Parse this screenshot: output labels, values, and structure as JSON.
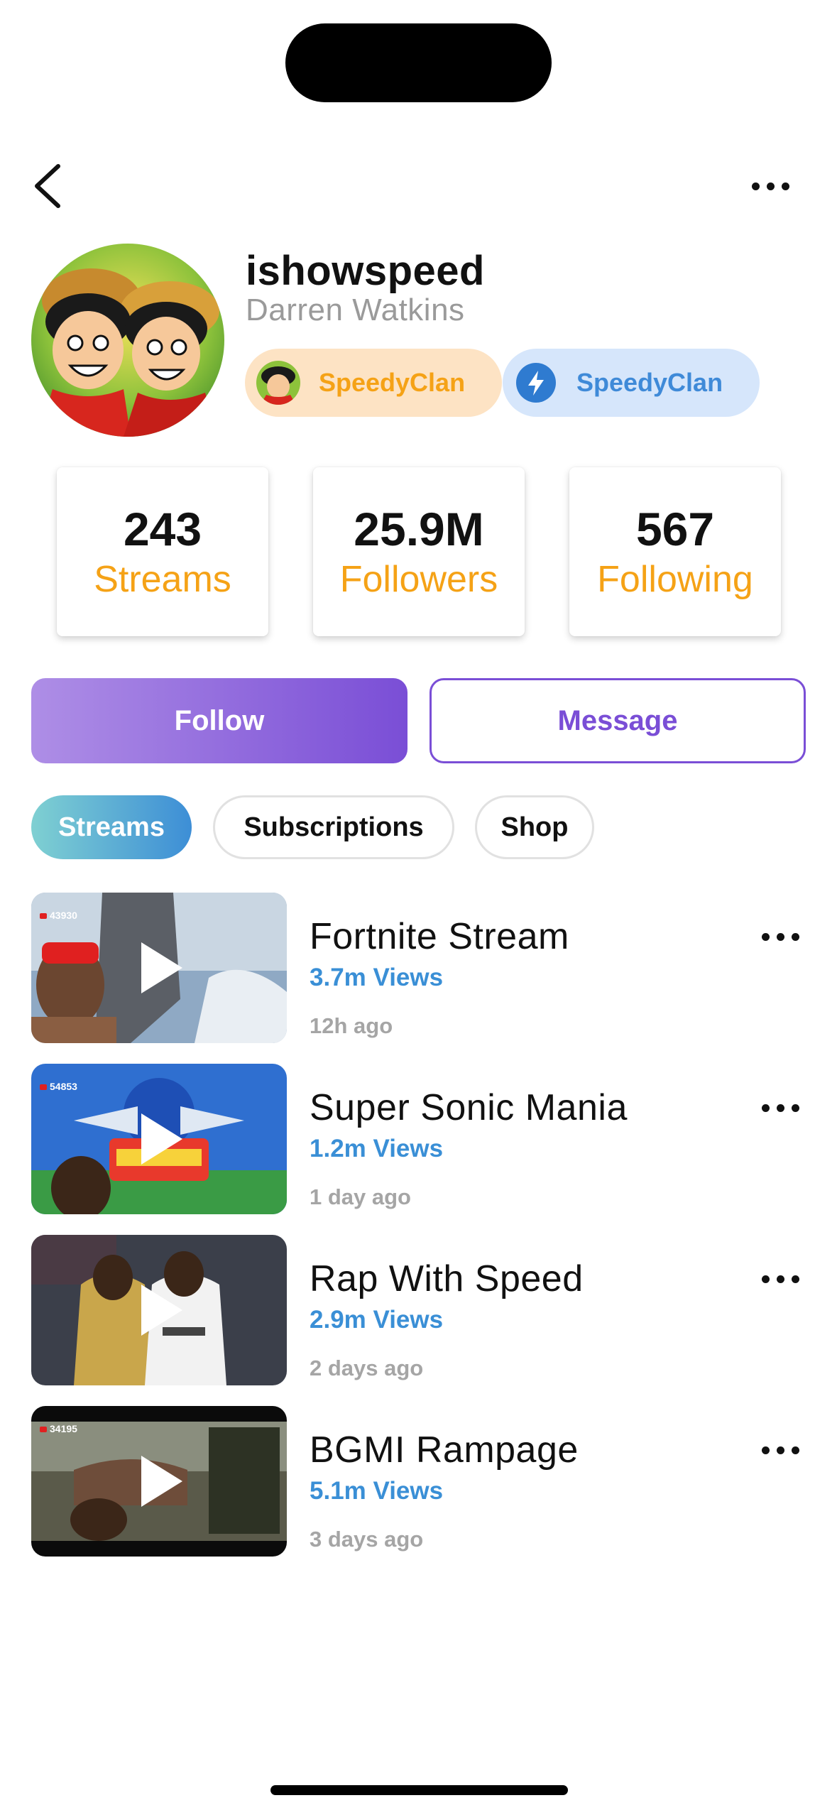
{
  "header": {
    "back_icon": "chevron-left-icon",
    "more_icon": "ellipsis-icon"
  },
  "profile": {
    "username": "ishowspeed",
    "real_name": "Darren Watkins",
    "badges": [
      {
        "label": "SpeedyClan",
        "icon": "clan-avatar-icon",
        "color": "#f5a216"
      },
      {
        "label": "SpeedyClan",
        "icon": "lightning-icon",
        "color": "#3f8ad8"
      }
    ]
  },
  "stats": [
    {
      "value": "243",
      "label": "Streams"
    },
    {
      "value": "25.9M",
      "label": "Followers"
    },
    {
      "value": "567",
      "label": "Following"
    }
  ],
  "actions": {
    "follow_label": "Follow",
    "message_label": "Message"
  },
  "tabs": [
    {
      "label": "Streams",
      "active": true
    },
    {
      "label": "Subscriptions",
      "active": false
    },
    {
      "label": "Shop",
      "active": false
    }
  ],
  "streams": [
    {
      "title": "Fortnite Stream",
      "views": "3.7m Views",
      "time": "12h ago",
      "viewer_count": "43930"
    },
    {
      "title": "Super Sonic Mania",
      "views": "1.2m Views",
      "time": "1 day ago",
      "viewer_count": "54853"
    },
    {
      "title": "Rap With Speed",
      "views": "2.9m Views",
      "time": "2 days ago",
      "viewer_count": ""
    },
    {
      "title": "BGMI Rampage",
      "views": "5.1m Views",
      "time": "3 days ago",
      "viewer_count": "34195"
    }
  ],
  "colors": {
    "accent_orange": "#f5a216",
    "accent_purple": "#7a4ed6",
    "accent_blue": "#3a8fd6",
    "muted_gray": "#a5a5a5"
  }
}
